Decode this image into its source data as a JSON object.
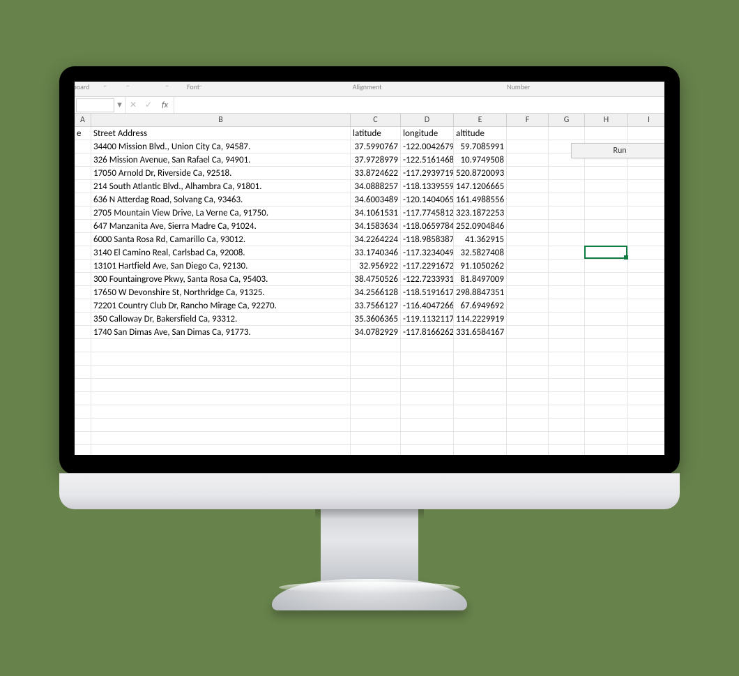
{
  "ribbon": {
    "group1": "ipboard",
    "group2": "Font",
    "group3": "Alignment",
    "group4": "Number"
  },
  "formula_bar": {
    "fx_label": "fx",
    "cancel_icon": "✕",
    "confirm_icon": "✓",
    "dropdown_icon": "▾",
    "value": ""
  },
  "columns": [
    "A",
    "B",
    "C",
    "D",
    "E",
    "F",
    "G",
    "H",
    "I"
  ],
  "headers": {
    "A": "e",
    "B": "Street Address",
    "C": "latitude",
    "D": "longitude",
    "E": "altitude"
  },
  "rows": [
    {
      "addr": "34400 Mission Blvd., Union City Ca, 94587.",
      "lat": "37.5990767",
      "lon": "-122.0042679",
      "alt": "59.7085991"
    },
    {
      "addr": "326 Mission Avenue, San Rafael Ca, 94901.",
      "lat": "37.9728979",
      "lon": "-122.5161468",
      "alt": "10.9749508"
    },
    {
      "addr": "17050 Arnold Dr, Riverside Ca, 92518.",
      "lat": "33.8724622",
      "lon": "-117.2939719",
      "alt": "520.8720093"
    },
    {
      "addr": "214 South Atlantic Blvd., Alhambra Ca, 91801.",
      "lat": "34.0888257",
      "lon": "-118.1339559",
      "alt": "147.1206665"
    },
    {
      "addr": "636 N Atterdag Road, Solvang Ca, 93463.",
      "lat": "34.6003489",
      "lon": "-120.1404065",
      "alt": "161.4988556"
    },
    {
      "addr": "2705 Mountain View Drive, La Verne Ca, 91750.",
      "lat": "34.1061531",
      "lon": "-117.7745812",
      "alt": "323.1872253"
    },
    {
      "addr": "647 Manzanita Ave, Sierra Madre Ca, 91024.",
      "lat": "34.1583634",
      "lon": "-118.0659784",
      "alt": "252.0904846"
    },
    {
      "addr": "6000 Santa Rosa Rd, Camarillo Ca, 93012.",
      "lat": "34.2264224",
      "lon": "-118.9858387",
      "alt": "41.362915"
    },
    {
      "addr": "3140 El Camino Real, Carlsbad Ca, 92008.",
      "lat": "33.1740346",
      "lon": "-117.3234049",
      "alt": "32.5827408"
    },
    {
      "addr": "13101 Hartfield Ave, San Diego Ca, 92130.",
      "lat": "32.956922",
      "lon": "-117.2291672",
      "alt": "91.1050262"
    },
    {
      "addr": "300 Fountaingrove Pkwy, Santa Rosa Ca, 95403.",
      "lat": "38.4750526",
      "lon": "-122.7233931",
      "alt": "81.8497009"
    },
    {
      "addr": "17650 W Devonshire St, Northridge Ca, 91325.",
      "lat": "34.2566128",
      "lon": "-118.5191617",
      "alt": "298.8847351"
    },
    {
      "addr": "72201 Country Club Dr, Rancho Mirage Ca, 92270.",
      "lat": "33.7566127",
      "lon": "-116.4047266",
      "alt": "67.6949692"
    },
    {
      "addr": "350 Calloway Dr, Bakersfield Ca, 93312.",
      "lat": "35.3606365",
      "lon": "-119.1132117",
      "alt": "114.2229919"
    },
    {
      "addr": "1740 San Dimas Ave, San Dimas Ca, 91773.",
      "lat": "34.0782929",
      "lon": "-117.8166262",
      "alt": "331.6584167"
    }
  ],
  "run_button": "Run",
  "active_cell": "H10",
  "blank_rows": 12
}
